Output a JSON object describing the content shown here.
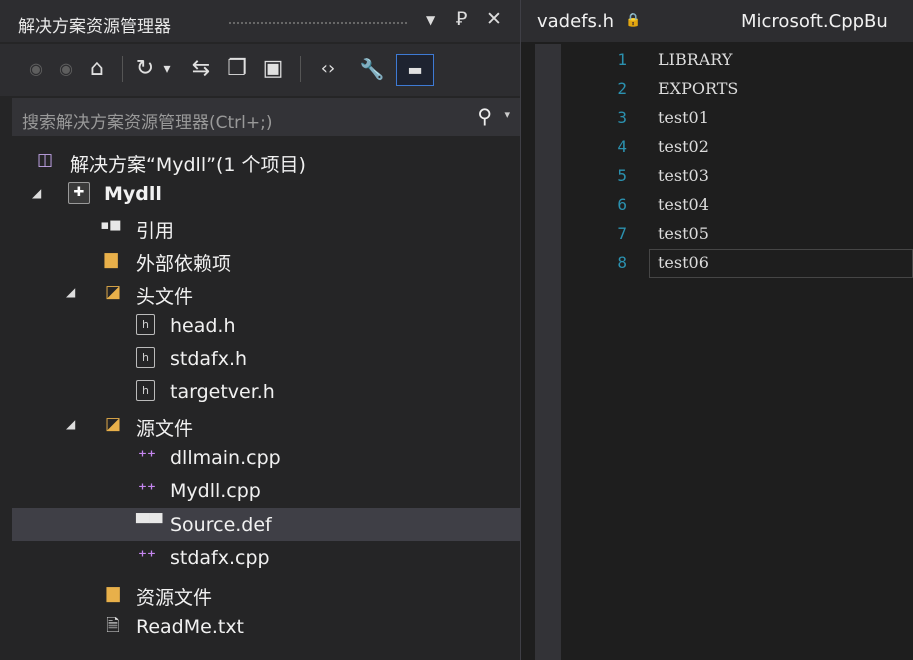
{
  "solution_explorer": {
    "title": "解决方案资源管理器",
    "title_icons": {
      "dropdown": "▼",
      "pin": "Ꝑ",
      "close": "✕"
    },
    "toolbar": {
      "back": "◉",
      "forward": "◉",
      "home": "⌂",
      "history": "↻",
      "history_dd": "▾",
      "sync": "⇆",
      "collapse": "❐",
      "show_all": "▣",
      "code": "‹›",
      "properties": "🔧",
      "preview": "▬"
    },
    "search": {
      "placeholder": "搜索解决方案资源管理器(Ctrl+;)",
      "icon": "⚲",
      "dropdown": "▾"
    },
    "tree": [
      {
        "label": "解决方案“Mydll”(1 个项目)",
        "icon": "solution-icon",
        "glyph": "◫",
        "level": 0
      },
      {
        "label": "Mydll",
        "icon": "project-icon",
        "glyph": "✚",
        "level": 0,
        "expanded": true,
        "bold": true
      },
      {
        "label": "引用",
        "icon": "references-icon",
        "glyph": "▪■",
        "level": 1
      },
      {
        "label": "外部依赖项",
        "icon": "external-deps-icon",
        "glyph": "▆",
        "level": 1
      },
      {
        "label": "头文件",
        "icon": "folder-icon",
        "glyph": "◪",
        "level": 1,
        "expanded": true
      },
      {
        "label": "head.h",
        "icon": "header-file-icon",
        "glyph": "h",
        "level": 2
      },
      {
        "label": "stdafx.h",
        "icon": "header-file-icon",
        "glyph": "h",
        "level": 2
      },
      {
        "label": "targetver.h",
        "icon": "header-file-icon",
        "glyph": "h",
        "level": 2
      },
      {
        "label": "源文件",
        "icon": "folder-icon",
        "glyph": "◪",
        "level": 1,
        "expanded": true
      },
      {
        "label": "dllmain.cpp",
        "icon": "cpp-file-icon",
        "glyph": "⁺⁺",
        "level": 2
      },
      {
        "label": "Mydll.cpp",
        "icon": "cpp-file-icon",
        "glyph": "⁺⁺",
        "level": 2
      },
      {
        "label": "Source.def",
        "icon": "def-file-icon",
        "glyph": "▀▀",
        "level": 2,
        "selected": true
      },
      {
        "label": "stdafx.cpp",
        "icon": "cpp-file-icon",
        "glyph": "⁺⁺",
        "level": 2
      },
      {
        "label": "资源文件",
        "icon": "folder-icon",
        "glyph": "▆",
        "level": 1
      },
      {
        "label": "ReadMe.txt",
        "icon": "text-file-icon",
        "glyph": "🗎",
        "level": 1
      }
    ]
  },
  "editor": {
    "tabs": [
      {
        "label": "vadefs.h",
        "icon_glyph": "🔒"
      },
      {
        "label": "Microsoft.CppBu"
      }
    ],
    "lines": [
      {
        "number": "1",
        "text": "LIBRARY"
      },
      {
        "number": "2",
        "text": "EXPORTS"
      },
      {
        "number": "3",
        "text": "test01"
      },
      {
        "number": "4",
        "text": "test02"
      },
      {
        "number": "5",
        "text": "test03"
      },
      {
        "number": "6",
        "text": "test04"
      },
      {
        "number": "7",
        "text": "test05"
      },
      {
        "number": "8",
        "text": "test06"
      }
    ],
    "current_line": 8
  },
  "colors": {
    "accent": "#3e7ad4",
    "line_number": "#2b91af",
    "selection": "#3f3f46"
  }
}
